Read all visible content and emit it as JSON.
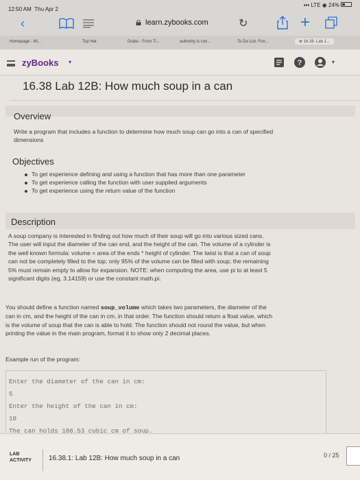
{
  "status": {
    "time": "12:50 AM",
    "day": "Thu Apr 2",
    "carrier": "LTE",
    "battery": "24%"
  },
  "browser": {
    "url": "learn.zybooks.com",
    "bookmarks": [
      "Homepage - Mi...",
      "Top Hat",
      "Drake - From Ti...",
      "authority is con...",
      "To-Do List: Fun...",
      "16.38. Lab 1..."
    ]
  },
  "header": {
    "logo": "zyBooks",
    "caret": "▾"
  },
  "page": {
    "title": "16.38 Lab 12B: How much soup in a can",
    "overview_heading": "Overview",
    "overview_line1": "Write a program that includes a function to determine how much soup can go into a can of specified",
    "overview_line2": "dimensions",
    "objectives_heading": "Objectives",
    "objectives": [
      "To get experience defining and using a function that has more than one parameter",
      "To get experience calling the function with user supplied arguments",
      "To get experience using the return value of the function"
    ],
    "description_heading": "Description",
    "description_lines": [
      "A soup company is interested in finding out how much of their soup will go into various sized cans.",
      "The user will input the diameter of the can end, and the height of the can. The volume of a cylinder is",
      "the well known formula: volume = area of the ends * height of cylinder. The twist is that a can of soup",
      "can not be completely filled to the top; only 95% of the volume can be filled with soup; the remaining",
      "5% must remain empty to allow for expansion. NOTE: when computing the area, use pi to at least 5",
      "significant digits (eg, 3.14159) or use the constant math.pi."
    ],
    "define_pre": "You should define a function named ",
    "define_code": "soup_volume",
    "define_post": " which takes two parameters, the diameter of the",
    "define_lines": [
      "can in cm, and the height of the can in cm, in that order. The function should return a float value, which",
      "is the volume of soup that the can is able to hold. The function should not round the value, but when",
      "printing the value in the main program, format it to show only 2 decimal places."
    ],
    "example_label": "Example run of the program:",
    "console": [
      "Enter the diameter of the can in cm:",
      "5",
      "Enter the height of the can in cm:",
      "10",
      "The can holds 186.53 cubic cm of soup."
    ]
  },
  "activity": {
    "label_line1": "LAB",
    "label_line2": "ACTIVITY",
    "title": "16.38.1: Lab 12B: How much soup in a can",
    "score": "0 / 25"
  }
}
